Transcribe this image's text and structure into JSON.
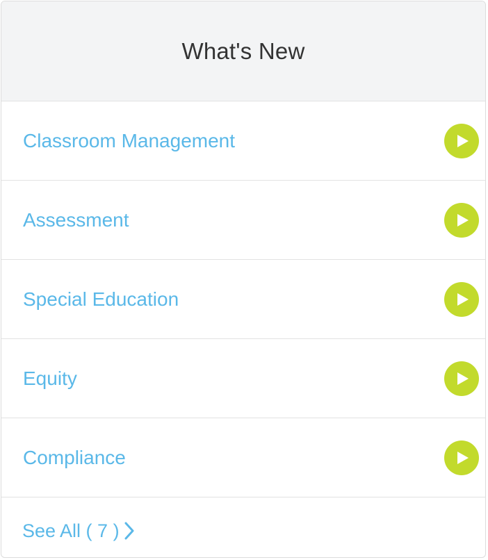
{
  "header": {
    "title": "What's New"
  },
  "items": [
    {
      "label": "Classroom Management",
      "icon": "play-icon"
    },
    {
      "label": "Assessment",
      "icon": "play-icon"
    },
    {
      "label": "Special Education",
      "icon": "play-icon"
    },
    {
      "label": "Equity",
      "icon": "play-icon"
    },
    {
      "label": "Compliance",
      "icon": "play-icon"
    }
  ],
  "footer": {
    "see_all_label": "See All ( 7 )",
    "icon": "chevron-right-icon"
  },
  "colors": {
    "header_bg": "#f3f4f5",
    "title_text": "#333333",
    "link_text": "#5ab8e8",
    "play_button": "#c2da2c",
    "play_triangle": "#ffffff",
    "divider": "#e2e2e2"
  }
}
